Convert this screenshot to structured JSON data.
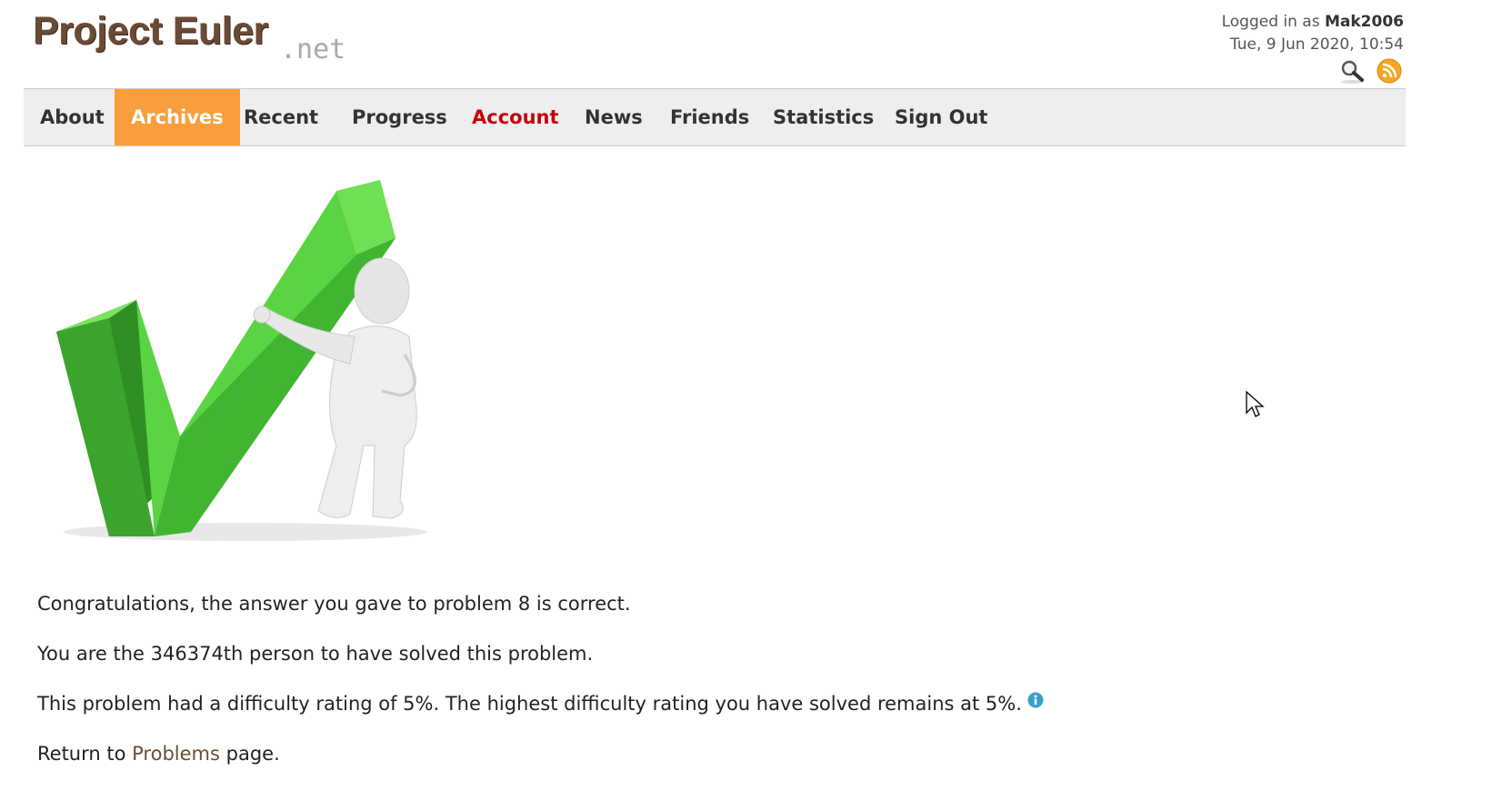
{
  "header": {
    "logo_main": "Project Euler",
    "logo_suffix": ".net",
    "logged_in_prefix": "Logged in as",
    "username": "Mak2006",
    "datetime": "Tue, 9 Jun 2020, 10:54",
    "icons": [
      "search-icon",
      "rss-icon"
    ]
  },
  "nav": {
    "items": [
      {
        "label": "About"
      },
      {
        "label": "Archives"
      },
      {
        "label": "Recent"
      },
      {
        "label": "Progress"
      },
      {
        "label": "Account"
      },
      {
        "label": "News"
      },
      {
        "label": "Friends"
      },
      {
        "label": "Statistics"
      },
      {
        "label": "Sign Out"
      }
    ],
    "active": "Archives",
    "highlight": "Account"
  },
  "result": {
    "line1": "Congratulations, the answer you gave to problem 8 is correct.",
    "line2": "You are the 346374th person to have solved this problem.",
    "line3": "This problem had a difficulty rating of 5%. The highest difficulty rating you have solved remains at 5%.",
    "return_prefix": "Return to",
    "return_link": "Problems",
    "return_suffix": "page."
  },
  "colors": {
    "logo": "#6b4a36",
    "nav_active_bg": "#f99e3d",
    "nav_account": "#c8000a",
    "link": "#6a4f2f",
    "checkmark": "#4cc23a"
  }
}
